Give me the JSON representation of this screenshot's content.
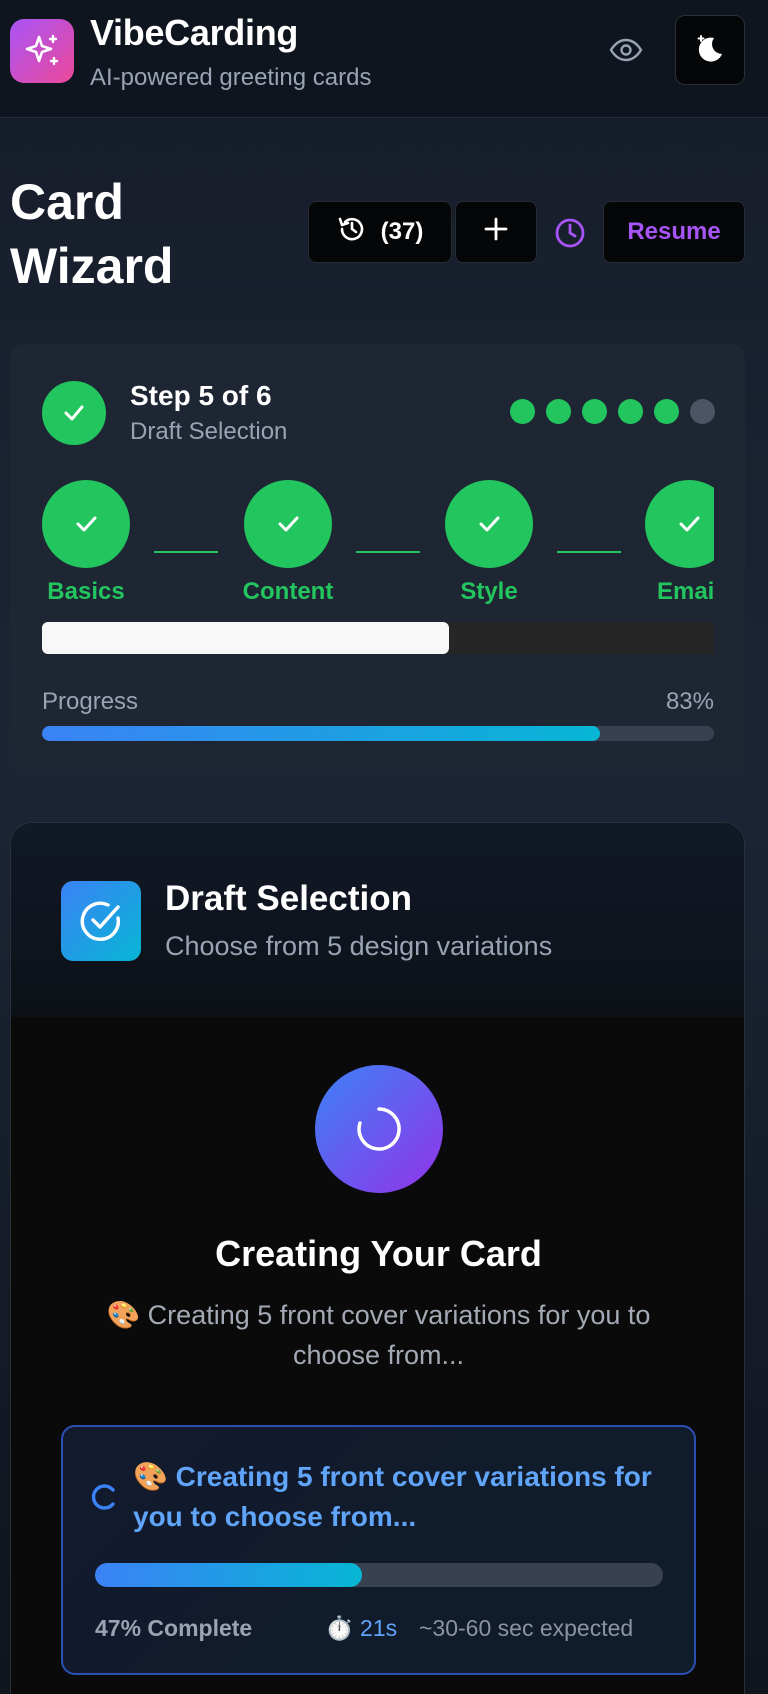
{
  "header": {
    "brand_title": "VibeCarding",
    "brand_subtitle": "AI-powered greeting cards",
    "logo_icon": "sparkles-icon",
    "eye_icon": "eye-icon",
    "theme_icon": "moon-stars-icon"
  },
  "page": {
    "title_line1": "Card",
    "title_line2": "Wizard"
  },
  "toolbar": {
    "history_count": "(37)",
    "history_icon": "history-icon",
    "new_icon": "plus-icon",
    "clock_icon": "clock-icon",
    "resume_label": "Resume",
    "accent_color": "#a855f7"
  },
  "step": {
    "title": "Step 5 of 6",
    "subtitle": "Draft Selection",
    "total_steps": 6,
    "completed_steps": 5,
    "steps": [
      {
        "label": "Basics",
        "status": "complete"
      },
      {
        "label": "Content",
        "status": "complete"
      },
      {
        "label": "Style",
        "status": "complete"
      },
      {
        "label": "Email",
        "status": "complete"
      }
    ],
    "progress_label": "Progress",
    "progress_percent": "83%",
    "progress_value": 0.83,
    "complete_color": "#22c55e"
  },
  "draft": {
    "title": "Draft Selection",
    "subtitle": "Choose from 5 design variations",
    "creating_title": "Creating Your Card",
    "creating_desc": "🎨 Creating 5 front cover variations for you to choose from...",
    "status_text": "🎨 Creating 5 front cover variations for you to choose from...",
    "status_progress_value": 0.47,
    "status_complete": "47% Complete",
    "status_time": "⏱️ 21s",
    "status_expected": "~30-60 sec expected"
  }
}
